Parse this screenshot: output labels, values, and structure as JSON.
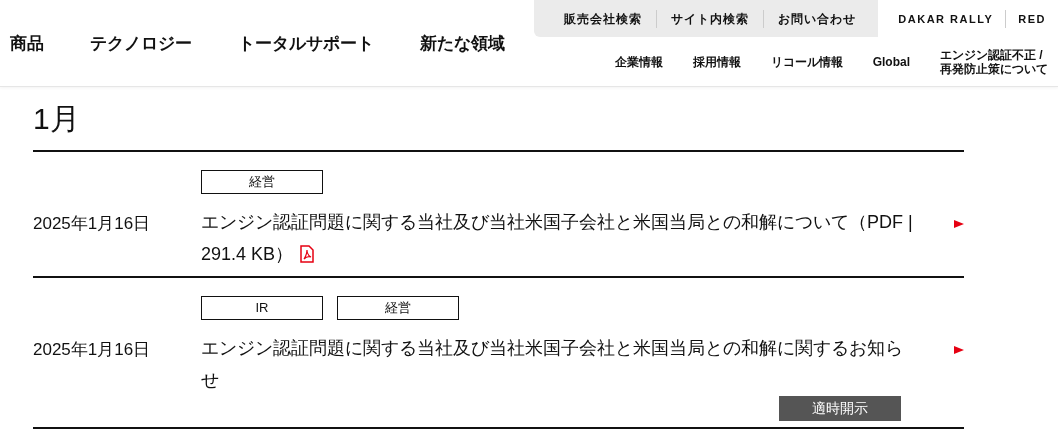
{
  "main_nav": [
    "商品",
    "テクノロジー",
    "トータルサポート",
    "新たな領域"
  ],
  "utility_nav": [
    "販売会社検索",
    "サイト内検索",
    "お問い合わせ"
  ],
  "brand_links": [
    "DAKAR RALLY",
    "RED"
  ],
  "sub_nav": [
    "企業情報",
    "採用情報",
    "リコール情報",
    "Global",
    "エンジン認証不正 / 再発防止策について"
  ],
  "month": "1月",
  "news": [
    {
      "tags": [
        "経営"
      ],
      "date": "2025年1月16日",
      "title": "エンジン認証問題に関する当社及び当社米国子会社と米国当局との和解について（PDF | 291.4 KB）",
      "pdf": true
    },
    {
      "tags": [
        "IR",
        "経営"
      ],
      "date": "2025年1月16日",
      "title": "エンジン認証問題に関する当社及び当社米国子会社と米国当局との和解に関するお知らせ",
      "pdf": false,
      "badge": "適時開示"
    }
  ]
}
